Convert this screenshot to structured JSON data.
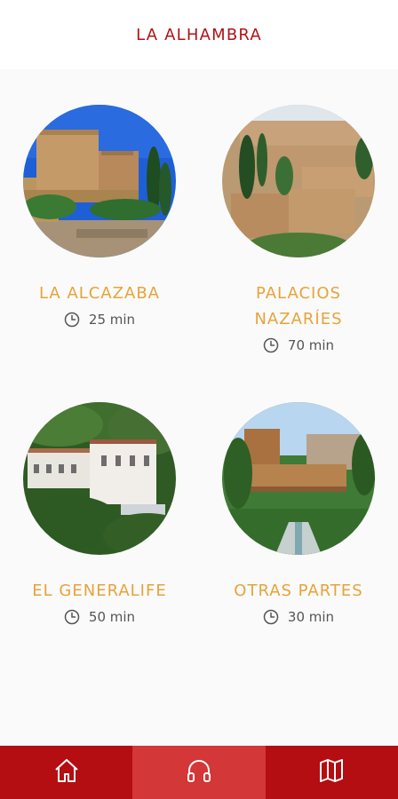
{
  "header": {
    "title": "LA ALHAMBRA"
  },
  "tours": [
    {
      "name": "LA ALCAZABA",
      "duration": "25 min",
      "image": "alcazaba-photo"
    },
    {
      "name": "PALACIOS NAZARÍES",
      "duration": "70 min",
      "image": "palacios-nazaries-photo"
    },
    {
      "name": "EL GENERALIFE",
      "duration": "50 min",
      "image": "generalife-photo"
    },
    {
      "name": "OTRAS PARTES",
      "duration": "30 min",
      "image": "otras-partes-photo"
    }
  ],
  "tabbar": {
    "tabs": [
      {
        "icon": "home-icon",
        "active": false
      },
      {
        "icon": "headphones-icon",
        "active": true
      },
      {
        "icon": "map-icon",
        "active": false
      }
    ]
  },
  "colors": {
    "brand_red": "#b40d12",
    "active_tab": "#d33737",
    "title_red": "#b11217",
    "card_title_orange": "#e7a339",
    "duration_text": "#555555",
    "background": "#fafafa"
  }
}
